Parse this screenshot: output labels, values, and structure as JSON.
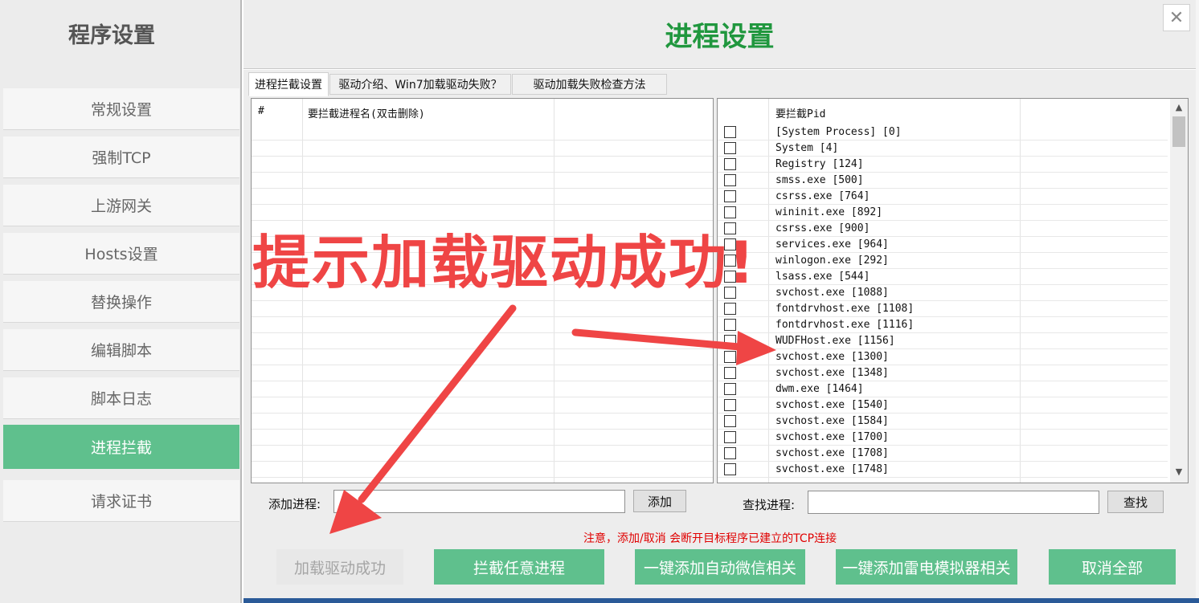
{
  "sidebar": {
    "title": "程序设置",
    "items": [
      {
        "label": "常规设置"
      },
      {
        "label": "强制TCP"
      },
      {
        "label": "上游网关"
      },
      {
        "label": "Hosts设置"
      },
      {
        "label": "替换操作"
      },
      {
        "label": "编辑脚本"
      },
      {
        "label": "脚本日志"
      },
      {
        "label": "进程拦截",
        "active": true
      },
      {
        "label": "请求证书"
      }
    ]
  },
  "header": {
    "title": "进程设置",
    "close_glyph": "✕"
  },
  "tabs": [
    {
      "label": "进程拦截设置",
      "active": true
    },
    {
      "label": "驱动介绍、Win7加载驱动失败？"
    },
    {
      "label": "驱动加载失败检查方法"
    }
  ],
  "left_list": {
    "col_index": "#",
    "col_name": "要拦截进程名(双击删除)"
  },
  "right_list": {
    "col_pid": "要拦截Pid",
    "rows": [
      "[System Process] [0]",
      "System [4]",
      "Registry [124]",
      "smss.exe [500]",
      "csrss.exe [764]",
      "wininit.exe [892]",
      "csrss.exe [900]",
      "services.exe [964]",
      "winlogon.exe [292]",
      "lsass.exe [544]",
      "svchost.exe [1088]",
      "fontdrvhost.exe [1108]",
      "fontdrvhost.exe [1116]",
      "WUDFHost.exe [1156]",
      "svchost.exe [1300]",
      "svchost.exe [1348]",
      "dwm.exe [1464]",
      "svchost.exe [1540]",
      "svchost.exe [1584]",
      "svchost.exe [1700]",
      "svchost.exe [1708]",
      "svchost.exe [1748]"
    ]
  },
  "add_process": {
    "label": "添加进程:",
    "value": "",
    "button": "添加"
  },
  "find_process": {
    "label": "查找进程:",
    "value": "",
    "button": "查找"
  },
  "notice": "注意，添加/取消 会断开目标程序已建立的TCP连接",
  "actions": {
    "load_driver": "加载驱动成功",
    "intercept_any": "拦截任意进程",
    "add_wechat": "一键添加自动微信相关",
    "add_leidian": "一键添加雷电模拟器相关",
    "cancel_all": "取消全部"
  },
  "annotation": {
    "text": "提示加载驱动成功!",
    "color": "#ef4545"
  },
  "colors": {
    "accent": "#5fc08d",
    "title_green": "#20973e",
    "warning": "#e00000"
  }
}
